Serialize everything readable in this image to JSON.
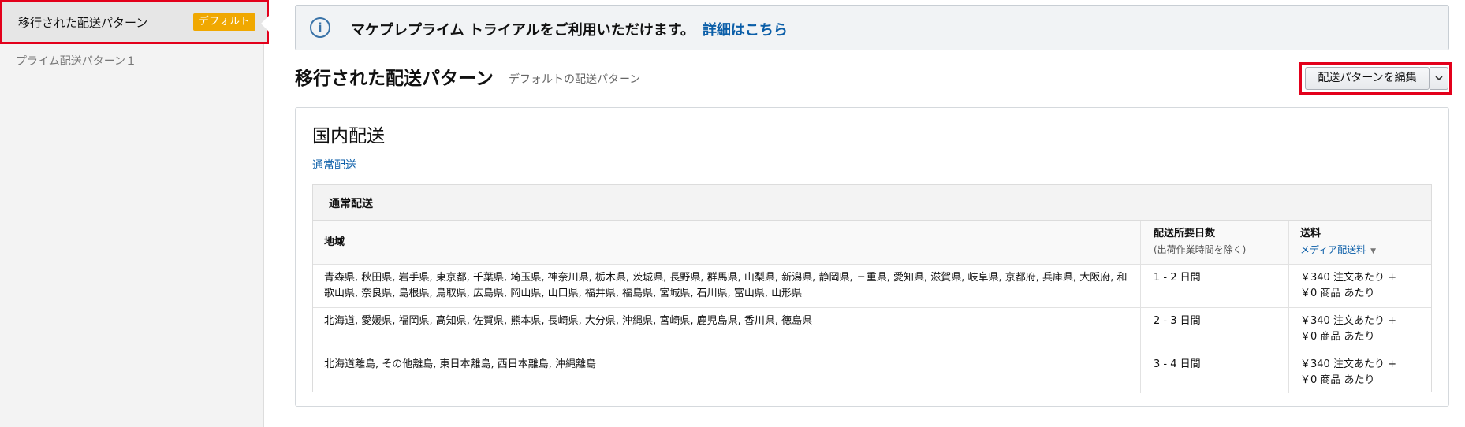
{
  "sidebar": {
    "items": [
      {
        "label": "移行された配送パターン",
        "badge": "デフォルト"
      },
      {
        "label": "プライム配送パターン１"
      }
    ]
  },
  "banner": {
    "icon": "info-icon",
    "text": "マケプレプライム トライアルをご利用いただけます。",
    "link": "詳細はこちら"
  },
  "header": {
    "title": "移行された配送パターン",
    "subtitle": "デフォルトの配送パターン",
    "edit_label": "配送パターンを編集"
  },
  "domestic": {
    "title": "国内配送",
    "link": "通常配送",
    "table_caption": "通常配送",
    "columns": {
      "region": "地域",
      "days": "配送所要日数",
      "days_note": "(出荷作業時間を除く)",
      "fee": "送料",
      "fee_link": "メディア配送料"
    },
    "rows": [
      {
        "region": "青森県, 秋田県, 岩手県, 東京都, 千葉県, 埼玉県, 神奈川県, 栃木県, 茨城県, 長野県, 群馬県, 山梨県, 新潟県, 静岡県, 三重県, 愛知県, 滋賀県, 岐阜県, 京都府, 兵庫県, 大阪府, 和歌山県, 奈良県, 島根県, 鳥取県, 広島県, 岡山県, 山口県, 福井県, 福島県, 宮城県, 石川県, 富山県, 山形県",
        "days": "1 - 2 日間",
        "fee_line1": "￥340 注文あたり +",
        "fee_line2": "￥0 商品 あたり"
      },
      {
        "region": "北海道, 愛媛県, 福岡県, 高知県, 佐賀県, 熊本県, 長崎県, 大分県, 沖縄県, 宮崎県, 鹿児島県, 香川県, 徳島県",
        "days": "2 - 3 日間",
        "fee_line1": "￥340 注文あたり +",
        "fee_line2": "￥0 商品 あたり"
      },
      {
        "region": "北海道離島, その他離島, 東日本離島, 西日本離島, 沖縄離島",
        "days": "3 - 4 日間",
        "fee_line1": "￥340 注文あたり +",
        "fee_line2": "￥0 商品 あたり"
      }
    ]
  },
  "colors": {
    "accent_link": "#0b5ea8",
    "badge": "#f0a800",
    "highlight": "#e3001b"
  }
}
